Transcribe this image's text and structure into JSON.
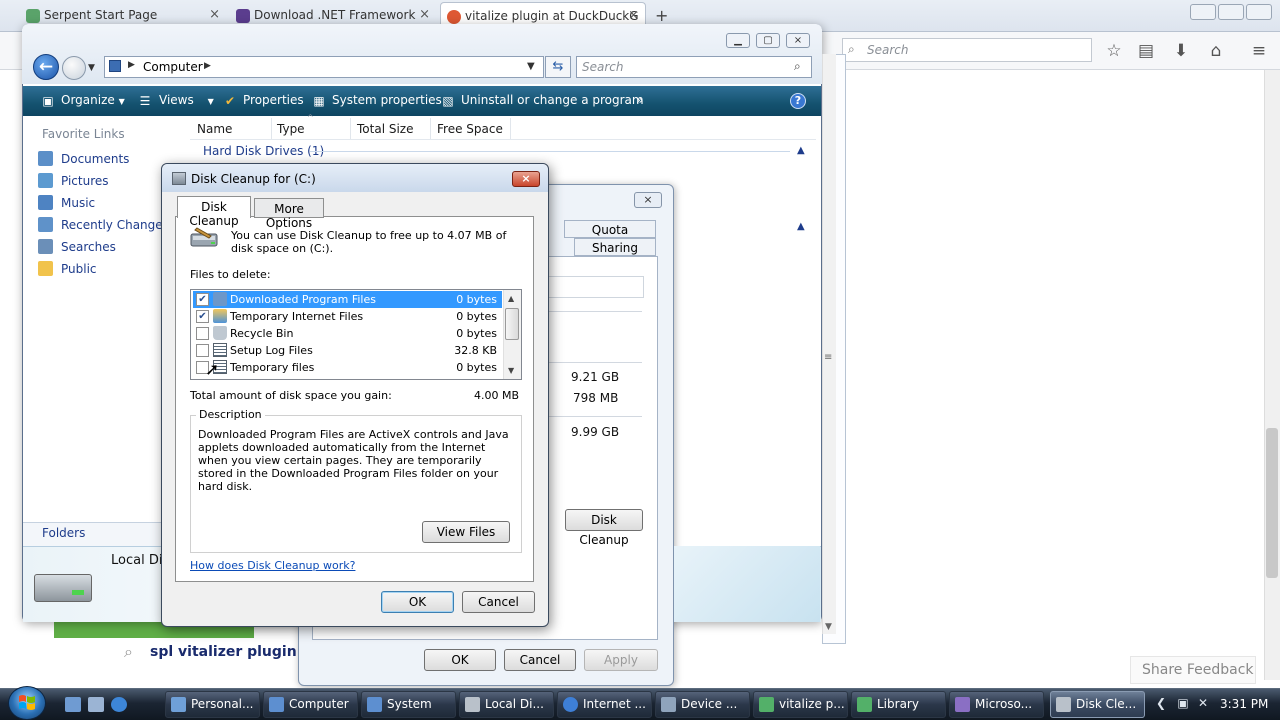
{
  "browser": {
    "tabs": [
      {
        "label": "Serpent Start Page",
        "icon": "serpent-icon"
      },
      {
        "label": "Download .NET Framework",
        "icon": "dotnet-icon"
      },
      {
        "label": "vitalize plugin at DuckDuckG",
        "icon": "duckduckgo-icon",
        "active": true
      }
    ],
    "new_tab_label": "+",
    "search_placeholder": "Search",
    "query_text": "spl vitalizer plugin",
    "share_feedback": "Share Feedback"
  },
  "explorer": {
    "address": "Computer",
    "search_placeholder": "Search",
    "toolbar": {
      "organize": "Organize",
      "views": "Views",
      "properties": "Properties",
      "system_properties": "System properties",
      "uninstall": "Uninstall or change a program",
      "more": "»",
      "help": "?"
    },
    "favorite_links_label": "Favorite Links",
    "favorite_links": [
      {
        "label": "Documents",
        "color": "#5b8fc8"
      },
      {
        "label": "Pictures",
        "color": "#5c9ad0"
      },
      {
        "label": "Music",
        "color": "#4e83c2"
      },
      {
        "label": "Recently Changed",
        "color": "#5f92c9"
      },
      {
        "label": "Searches",
        "color": "#6b8fb8"
      },
      {
        "label": "Public",
        "color": "#f1c34c"
      }
    ],
    "folders_label": "Folders",
    "columns": [
      "Name",
      "Type",
      "Total Size",
      "Free Space"
    ],
    "group_label": "Hard Disk Drives (1)",
    "details_name": "Local Dis"
  },
  "properties_window": {
    "close": "×",
    "tabs": [
      "Quota",
      "Sharing"
    ],
    "values": [
      "9.21 GB",
      "798 MB",
      "9.99 GB"
    ],
    "disk_cleanup_button": "Disk Cleanup",
    "ok": "OK",
    "cancel": "Cancel",
    "apply": "Apply"
  },
  "disk_cleanup": {
    "title": "Disk Cleanup for  (C:)",
    "close": "×",
    "tabs": [
      "Disk Cleanup",
      "More Options"
    ],
    "intro": "You can use Disk Cleanup to free up to 4.07 MB of disk space on  (C:).",
    "files_label": "Files to delete:",
    "files": [
      {
        "label": "Downloaded Program Files",
        "size": "0 bytes",
        "checked": true,
        "selected": true
      },
      {
        "label": "Temporary Internet Files",
        "size": "0 bytes",
        "checked": true,
        "selected": false
      },
      {
        "label": "Recycle Bin",
        "size": "0 bytes",
        "checked": false,
        "selected": false
      },
      {
        "label": "Setup Log Files",
        "size": "32.8 KB",
        "checked": false,
        "selected": false
      },
      {
        "label": "Temporary files",
        "size": "0 bytes",
        "checked": false,
        "selected": false
      }
    ],
    "total_label": "Total amount of disk space you gain:",
    "total_value": "4.00 MB",
    "description_label": "Description",
    "description": "Downloaded Program Files are ActiveX controls and Java applets downloaded automatically from the Internet when you view certain pages. They are temporarily stored in the Downloaded Program Files folder on your hard disk.",
    "view_files": "View Files",
    "how_link": "How does Disk Cleanup work?",
    "ok": "OK",
    "cancel": "Cancel"
  },
  "taskbar": {
    "buttons": [
      {
        "label": "Personal...",
        "color": "#6fa0d8"
      },
      {
        "label": "Computer",
        "color": "#5d8fd0"
      },
      {
        "label": "System",
        "color": "#5d8fd0"
      },
      {
        "label": "Local Di...",
        "color": "#b9c1ca"
      },
      {
        "label": "Internet ...",
        "color": "#3e7fd6"
      },
      {
        "label": "Device ...",
        "color": "#8fa4bc"
      },
      {
        "label": "vitalize p...",
        "color": "#53b069"
      },
      {
        "label": "Library",
        "color": "#53b069"
      },
      {
        "label": "Microso...",
        "color": "#8a6fc4"
      },
      {
        "label": "Disk Cle...",
        "color": "#b9c1ca",
        "active": true
      }
    ],
    "clock": "3:31 PM"
  }
}
